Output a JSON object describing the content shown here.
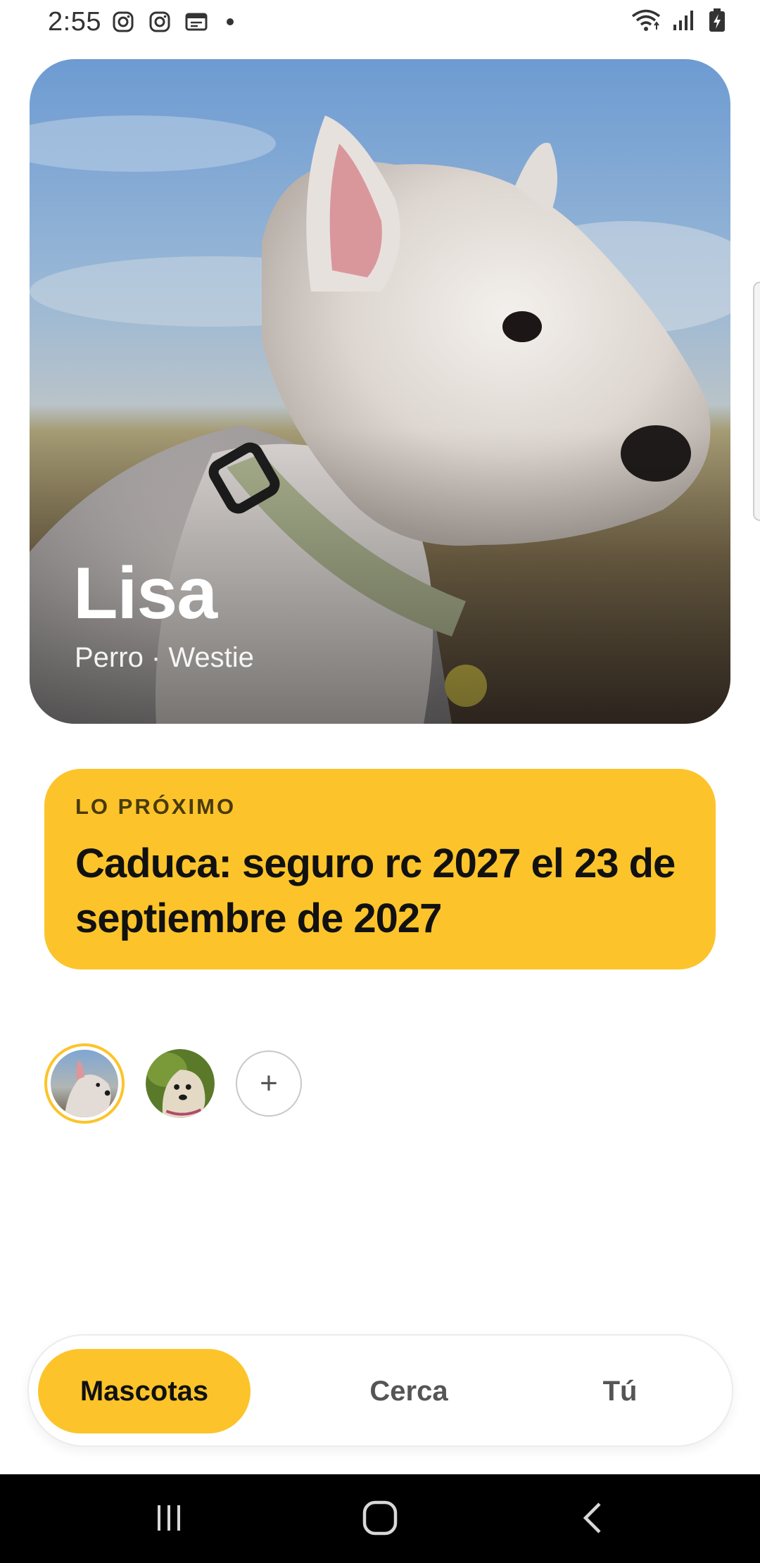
{
  "status_bar": {
    "time": "2:55",
    "left_icons": [
      "instagram-icon",
      "instagram-icon",
      "calendar-icon",
      "dot"
    ],
    "right_icons": [
      "wifi-icon",
      "signal-icon",
      "battery-charging-icon"
    ]
  },
  "pet": {
    "name": "Lisa",
    "subtitle": "Perro · Westie"
  },
  "upcoming": {
    "label": "LO PRÓXIMO",
    "text": "Caduca: seguro rc 2027 el 23 de septiembre de 2027"
  },
  "pet_switcher": {
    "add_label": "+"
  },
  "nav": {
    "items": [
      {
        "label": "Mascotas",
        "active": true
      },
      {
        "label": "Cerca",
        "active": false
      },
      {
        "label": "Tú",
        "active": false
      }
    ]
  },
  "colors": {
    "accent": "#FCC42A",
    "text": "#111111",
    "muted": "#555555"
  }
}
